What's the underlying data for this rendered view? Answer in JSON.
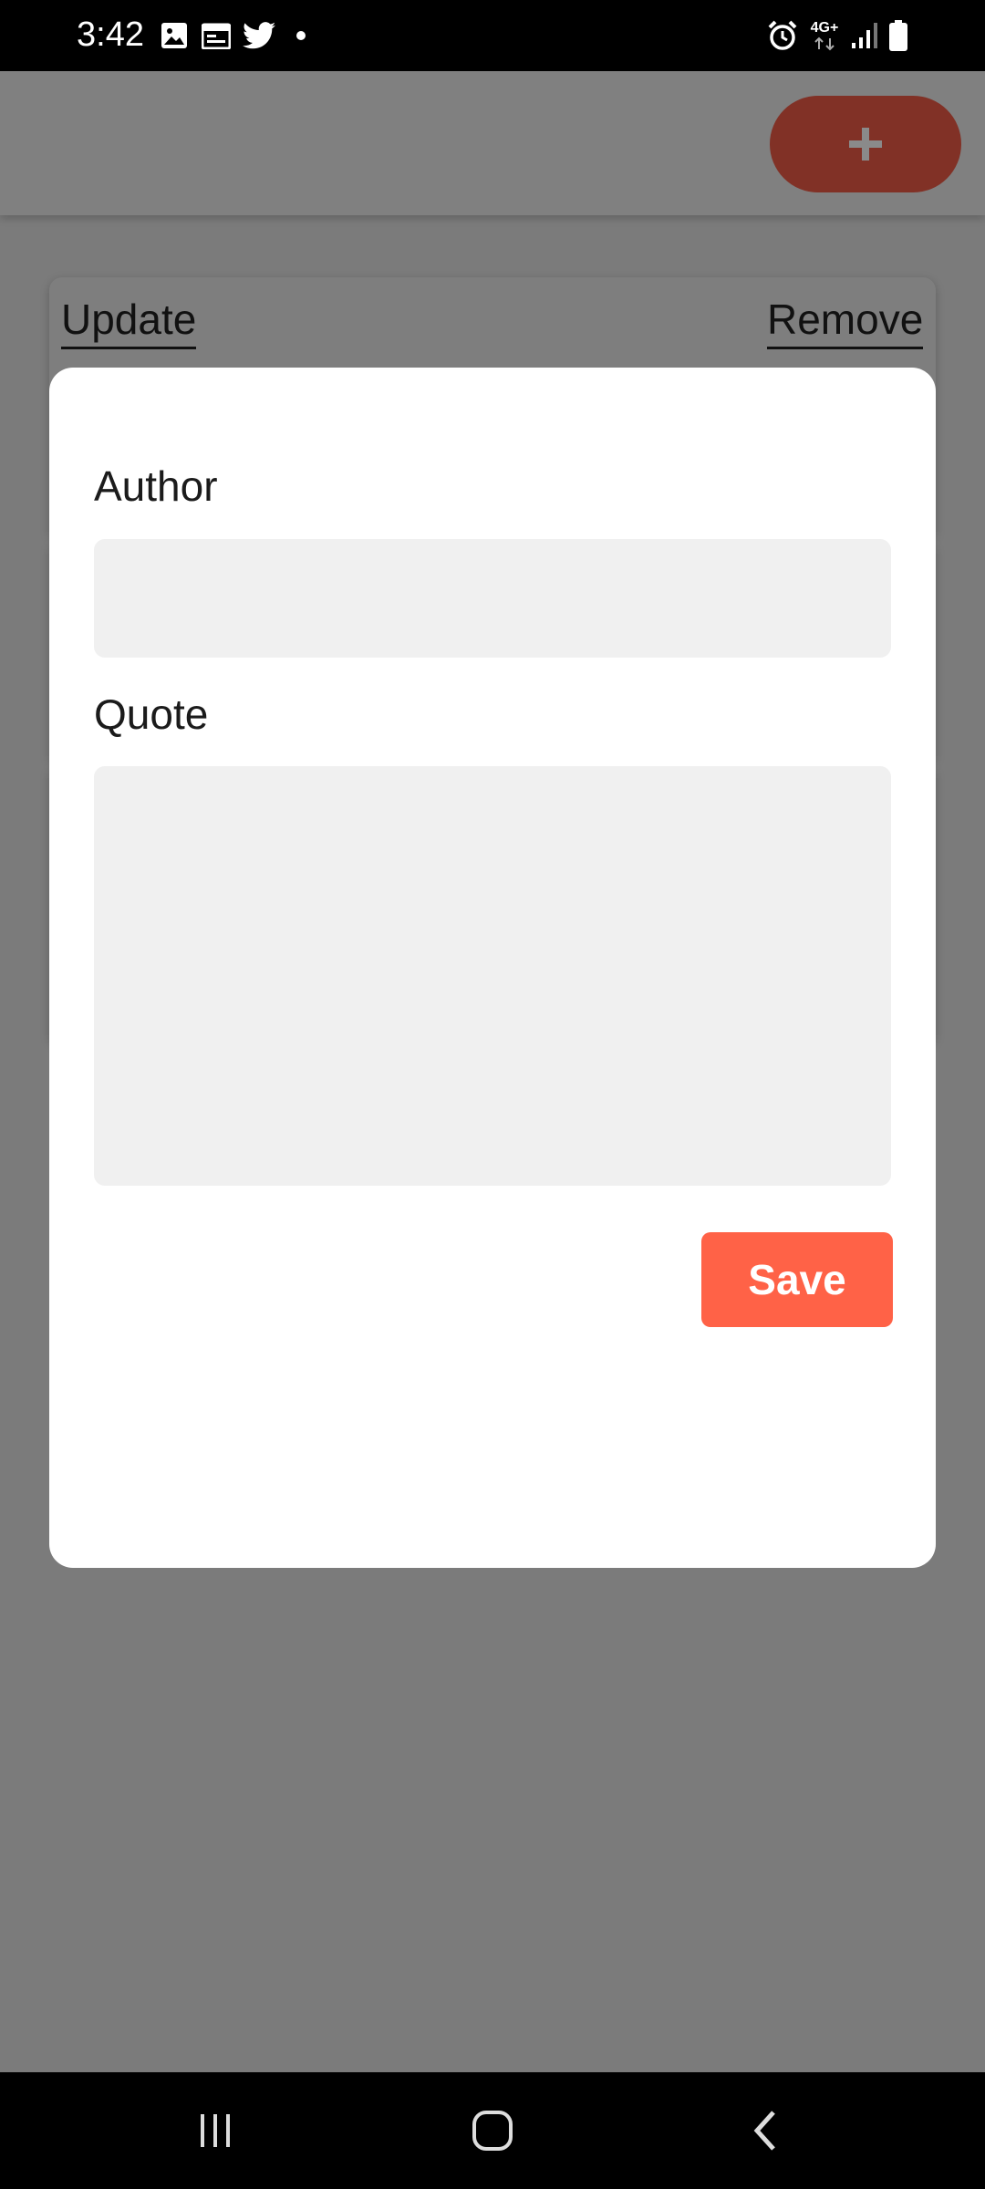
{
  "status_bar": {
    "time": "3:42",
    "left_icons": [
      "gallery-icon",
      "calendar-icon",
      "twitter-icon",
      "dot-icon"
    ],
    "right_icons": [
      "alarm-icon",
      "network-4g-icon",
      "signal-icon",
      "battery-icon"
    ],
    "network_label": "4G+"
  },
  "app": {
    "add_button_label": "+",
    "card": {
      "update_label": "Update",
      "remove_label": "Remove"
    }
  },
  "modal": {
    "author_label": "Author",
    "author_value": "",
    "quote_label": "Quote",
    "quote_value": "",
    "save_label": "Save"
  },
  "nav_bar": {
    "buttons": [
      "recents-icon",
      "home-icon",
      "back-icon"
    ]
  },
  "colors": {
    "accent": "#ff6247",
    "dimmed_accent": "#813126",
    "scrim": "#7b7b7b",
    "input_bg": "#f0f0f0"
  }
}
